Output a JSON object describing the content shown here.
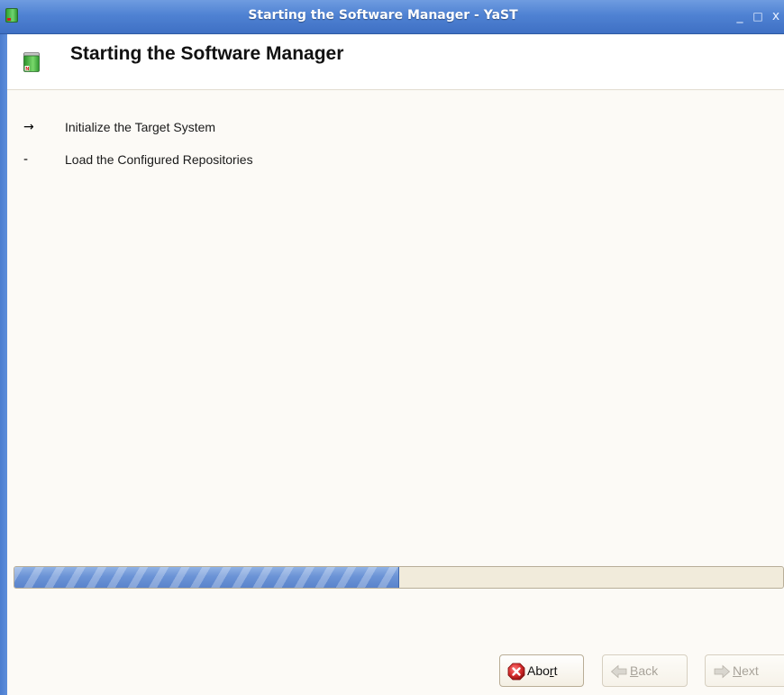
{
  "window": {
    "title": "Starting the Software Manager - YaST",
    "controls": {
      "minimize": "_",
      "maximize": "□",
      "close": "x"
    }
  },
  "header": {
    "title": "Starting the Software Manager",
    "icon": "yast-software-icon"
  },
  "steps": [
    {
      "marker": "→",
      "label": "Initialize the Target System",
      "state": "current"
    },
    {
      "marker": "-",
      "label": "Load the Configured Repositories",
      "state": "pending"
    }
  ],
  "progress": {
    "fraction": 0.5
  },
  "buttons": {
    "abort": {
      "pre": "Abo",
      "accel": "r",
      "post": "t",
      "icon": "abort-x-icon"
    },
    "back": {
      "pre": "",
      "accel": "B",
      "post": "ack",
      "icon": "back-arrow-icon",
      "disabled": true
    },
    "next": {
      "pre": "",
      "accel": "N",
      "post": "ext",
      "icon": "next-arrow-icon",
      "disabled": true
    }
  },
  "colors": {
    "titlebar": "#4f82d3",
    "progress_fill": "#6b93d6",
    "background": "#fcfaf6",
    "abort_red": "#d42a2a"
  }
}
